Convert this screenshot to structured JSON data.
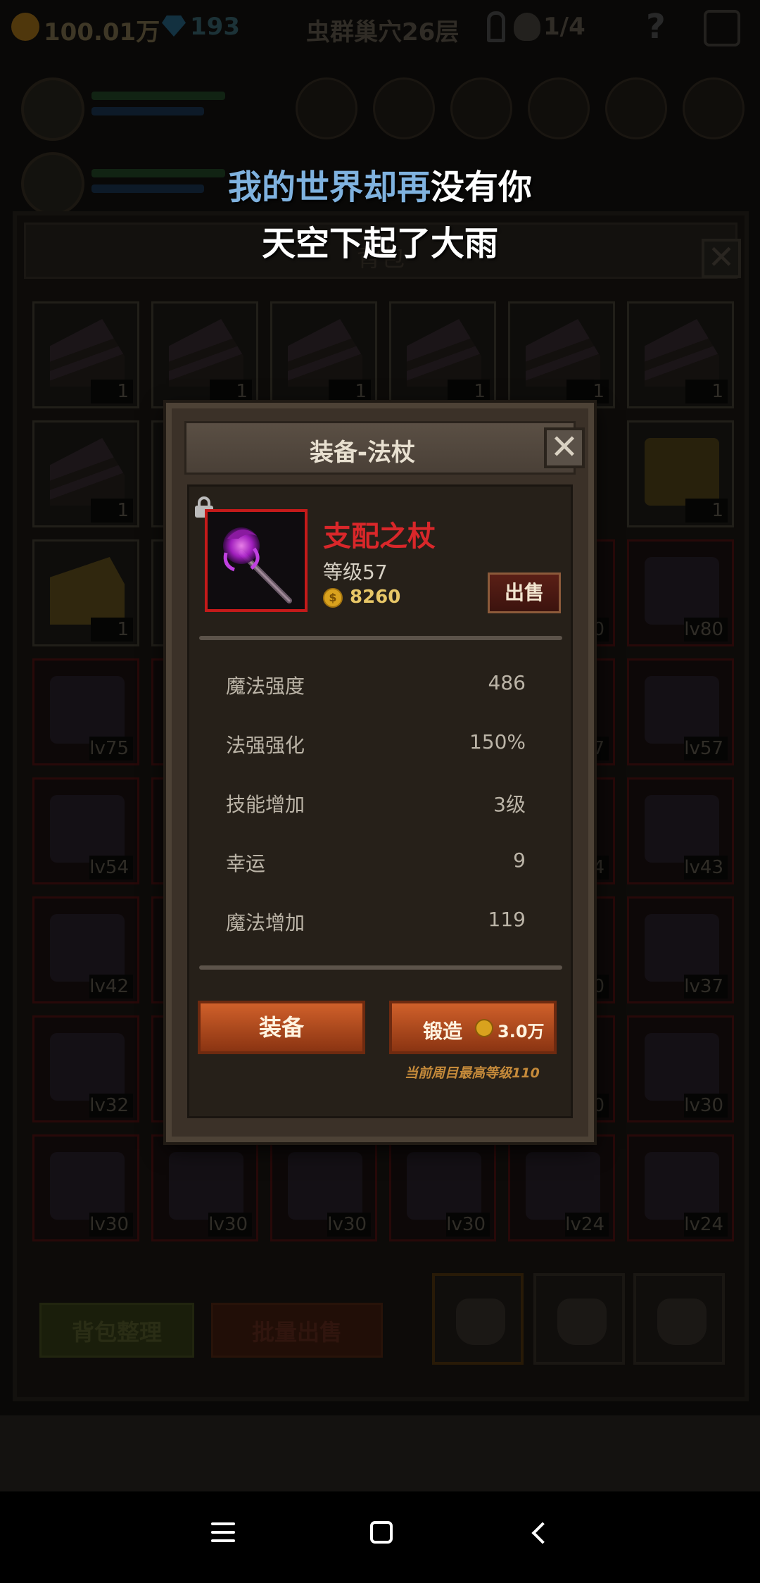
{
  "topbar": {
    "gold": "100.01万",
    "gems": "193",
    "stage": "虫群巢穴26层",
    "lives": "1/4",
    "help": "?"
  },
  "bag": {
    "title": "背包",
    "close": "✕",
    "slot_counts": [
      "1",
      "1",
      "1",
      "1",
      "1",
      "1",
      "1",
      "1",
      "1"
    ],
    "slot_levels": [
      "lv80",
      "lv75",
      "lv57",
      "lv54",
      "lv43",
      "lv42",
      "lv37",
      "lv32",
      "lv30",
      "lv30",
      "lv30",
      "lv30",
      "lv30",
      "lv24",
      "lv24"
    ],
    "partial_levels": [
      "0",
      "7",
      "4",
      "0",
      "0",
      "0"
    ],
    "sort_button": "背包整理",
    "bulk_sell_button": "批量出售"
  },
  "lyrics": {
    "line1_highlight": "我的世界却再",
    "line1_rest": "没有你",
    "line2": "天空下起了大雨"
  },
  "dialog": {
    "title": "装备-法杖",
    "close": "✕",
    "item_name": "支配之杖",
    "item_level": "等级57",
    "coin_symbol": "$",
    "price": "8260",
    "sell_button": "出售",
    "stats": [
      {
        "label": "魔法强度",
        "value": "486"
      },
      {
        "label": "法强强化",
        "value": "150%"
      },
      {
        "label": "技能增加",
        "value": "3级"
      },
      {
        "label": "幸运",
        "value": "9"
      },
      {
        "label": "魔法增加",
        "value": "119"
      }
    ],
    "equip_button": "装备",
    "forge_button": "锻造",
    "forge_cost": "3.0万",
    "level_note": "当前周目最高等级110"
  },
  "colors": {
    "item_name": "#d9272a",
    "button": "#c0551f",
    "lyric_highlight": "#7fb2df"
  }
}
